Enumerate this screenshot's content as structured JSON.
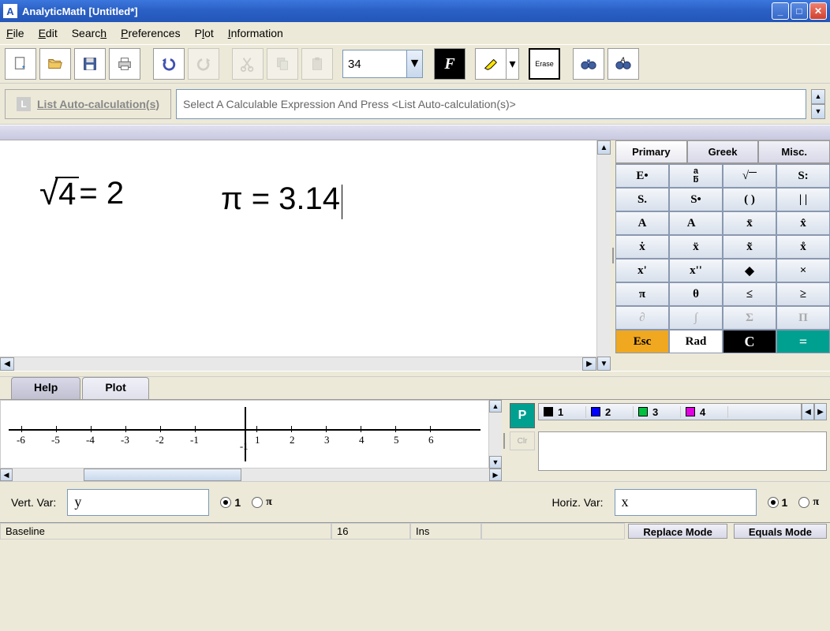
{
  "window": {
    "title": "AnalyticMath  [Untitled*]",
    "app_icon_letter": "A"
  },
  "menu": {
    "file": "File",
    "edit": "Edit",
    "search": "Search",
    "preferences": "Preferences",
    "plot": "Plot",
    "information": "Information"
  },
  "toolbar": {
    "font_size": "34",
    "f_label": "F",
    "erase_label": "Erase"
  },
  "autocalc": {
    "button_label": "List Auto-calculation(s)",
    "message": "Select A Calculable Expression And Press <List Auto-calculation(s)>"
  },
  "editor": {
    "expr1_radicand": "4",
    "expr1_eq": " = 2",
    "expr2": "π = 3.14"
  },
  "palette": {
    "tabs": {
      "primary": "Primary",
      "greek": "Greek",
      "misc": "Misc."
    },
    "rows": [
      [
        "E•",
        "a/b",
        "√",
        "S:"
      ],
      [
        "S.",
        "S•",
        "( )",
        "| |"
      ],
      [
        "A",
        "A⃗",
        "x̄",
        "x̂"
      ],
      [
        "ẋ",
        "ẍ",
        "x̃",
        "x̊"
      ],
      [
        "x'",
        "x''",
        "◆",
        "×"
      ],
      [
        "π",
        "θ",
        "≤",
        "≥"
      ],
      [
        "∂",
        "∫",
        "Σ",
        "Π"
      ]
    ],
    "bottom": {
      "esc": "Esc",
      "rad": "Rad",
      "c": "C",
      "eq": "="
    },
    "inactive_rows": [
      6
    ]
  },
  "bottom_tabs": {
    "help": "Help",
    "plot": "Plot"
  },
  "plot": {
    "ticks_neg": [
      "-6",
      "-5",
      "-4",
      "-3",
      "-2",
      "-1"
    ],
    "ticks_pos": [
      "1",
      "2",
      "3",
      "4",
      "5",
      "6"
    ],
    "y_neg1": "-1",
    "p_label": "P",
    "clr_label": "Clr",
    "series": [
      {
        "num": "1",
        "color": "#000000"
      },
      {
        "num": "2",
        "color": "#0000ff"
      },
      {
        "num": "3",
        "color": "#00c040"
      },
      {
        "num": "4",
        "color": "#e000e0"
      }
    ]
  },
  "vars": {
    "vert_label": "Vert. Var:",
    "vert_value": "y",
    "horiz_label": "Horiz. Var:",
    "horiz_value": "x",
    "radio_1": "1",
    "radio_pi": "π"
  },
  "status": {
    "baseline": "Baseline",
    "col": "16",
    "ins": "Ins",
    "replace": "Replace Mode",
    "equals": "Equals Mode"
  }
}
